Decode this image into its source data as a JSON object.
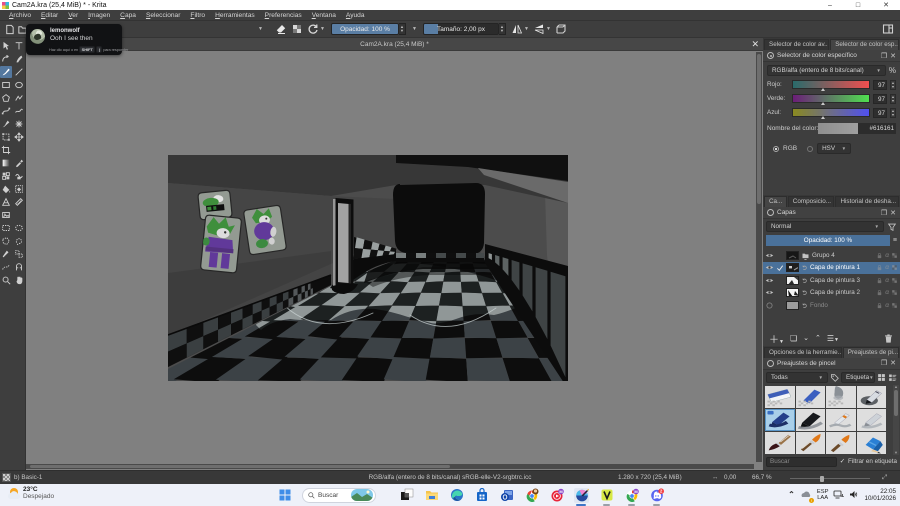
{
  "window": {
    "title": "Cam2A.kra (25,4 MiB) * - Krita",
    "controls": {
      "minimize": "–",
      "maximize": "□",
      "close": "✕"
    }
  },
  "menubar": [
    "Archivo",
    "Editar",
    "Ver",
    "Imagen",
    "Capa",
    "Seleccionar",
    "Filtro",
    "Herramientas",
    "Preferencias",
    "Ventana",
    "Ayuda"
  ],
  "toolbar": {
    "opacity_label": "Opacidad: 100 %",
    "size_label": "Tamaño: 2,00 px",
    "icons_left": [
      "new-document-icon",
      "open-document-icon"
    ],
    "icons_mid": [
      "eraser-icon",
      "preserve-alpha-icon",
      "reload-preset-icon"
    ],
    "icons_right": [
      "mirror-horizontal-icon",
      "mirror-vertical-icon",
      "wrap-around-icon"
    ],
    "workspace_icon": "workspace-chooser-icon"
  },
  "notification": {
    "username": "lemonwolf",
    "message": "Ooh I see then",
    "hint_prefix": "Haz clic aquí o en",
    "key1": "SHIFT",
    "key2": "|",
    "hint_suffix": "para responder"
  },
  "subwindow": {
    "title": "Cam2A.kra (25,4 MiB) *",
    "close": "✕"
  },
  "toolbox": {
    "active_tool": "freehand-brush",
    "tools": [
      "select-shapes",
      "text",
      "edit-shapes",
      "calligraphy",
      "freehand-brush",
      "line",
      "rectangle",
      "ellipse",
      "polygon",
      "polyline",
      "bezier-curve",
      "freehand-path",
      "dynamic-brush",
      "multibrush",
      "transform",
      "move",
      "crop",
      "blank",
      "gradient",
      "color-sampler",
      "pattern-edit",
      "smart-patch",
      "fill",
      "enclose-fill",
      "assistants",
      "measure",
      "reference-images",
      "blank",
      "select-rectangular",
      "select-elliptical",
      "select-polygonal",
      "select-freehand",
      "select-contiguous",
      "select-similar",
      "select-bezier",
      "select-magnetic",
      "zoom",
      "pan"
    ]
  },
  "color_docker": {
    "tab_left": "Selector de color av...",
    "tab_right": "Selector de color esp...",
    "title": "Selector de color específico",
    "model_combo": "RGB/alfa (entero de 8 bits/canal)",
    "percent": "%",
    "channels": [
      {
        "label": "Rojo:",
        "value": "97",
        "from": "#296b6b",
        "to": "#f04f4f"
      },
      {
        "label": "Verde:",
        "value": "97",
        "from": "#6b1d78",
        "to": "#4fe04f"
      },
      {
        "label": "Azul:",
        "value": "97",
        "from": "#8a8a20",
        "to": "#5050f0"
      }
    ],
    "color_name_label": "Nombre del color:",
    "color_hex": "#616161",
    "radio1": "RGB",
    "radio2_combo": "HSV"
  },
  "layers_docker": {
    "tabs": [
      "Ca...",
      "Composicio...",
      "Historial de desha..."
    ],
    "title": "Capas",
    "blend_mode": "Normal",
    "opacity_label": "Opacidad:  100 %",
    "layers": [
      {
        "name": "Grupo 4",
        "type": "group",
        "selected": false,
        "dim": false,
        "checked": false
      },
      {
        "name": "Capa de pintura 1",
        "type": "paint",
        "selected": true,
        "dim": false,
        "checked": true
      },
      {
        "name": "Capa de pintura 3",
        "type": "paint",
        "selected": false,
        "dim": false,
        "checked": false
      },
      {
        "name": "Capa de pintura 2",
        "type": "paint",
        "selected": false,
        "dim": false,
        "checked": false
      },
      {
        "name": "Fondo",
        "type": "paint",
        "selected": false,
        "dim": true,
        "checked": false
      }
    ]
  },
  "brush_docker": {
    "tab_left": "Opciones de la herramie...",
    "tab_right": "Preajustes de pi...",
    "title": "Preajustes de pincel",
    "filter_combo": "Todas",
    "tag_label": "Etiqueta",
    "search_placeholder": "Buscar",
    "filter_checkbox": "Filtrar en etiqueta",
    "presets": [
      "eraser-block",
      "pen-blue",
      "airbrush-soft",
      "ink-pen",
      "pencil-selected",
      "marker-black",
      "pen-orange",
      "pencil-gray",
      "brush-dark",
      "brush-orange",
      "brush-orange2",
      "pencil-blue"
    ],
    "selected_index": 4
  },
  "statusbar": {
    "brush_name": "b) Basic-1",
    "colorspace": "RGB/alfa (entero de 8 bits/canal)  sRGB-elle-V2-srgbtrc.icc",
    "size": "1.280 x 720 (25,4 MiB)",
    "angle": "0,00",
    "zoom": "66,7 %"
  },
  "taskbar": {
    "weather_temp": "23°C",
    "weather_desc": "Despejado",
    "search_placeholder": "Buscar",
    "icons": [
      "task-view",
      "explorer",
      "edge",
      "store",
      "outlook",
      "chrome-profile",
      "ytmusic",
      "krita",
      "vesktop",
      "chrome-m",
      "discord"
    ],
    "tray_lang1": "ESP",
    "tray_lang2": "LAA",
    "time": "22:05",
    "date": "10/01/2026"
  },
  "artwork": {
    "wall": "#4c4c4c",
    "wall_left": "#454545",
    "ceiling": "#373737",
    "ceiling_light": "#6a6a6a",
    "black": "#0c0c0c",
    "top_band": "#151515",
    "tile_dark": "#0d0d0d",
    "tile_gray": "#3c4246",
    "tile_light": "#909797",
    "rail_white": "#c9c9c9",
    "door_light": "#a2a2a2",
    "door_dark": "#1f1f1f",
    "poster_bg": "#939a92",
    "poster_green": "#3f8f3c",
    "poster_purple": "#61399a"
  }
}
